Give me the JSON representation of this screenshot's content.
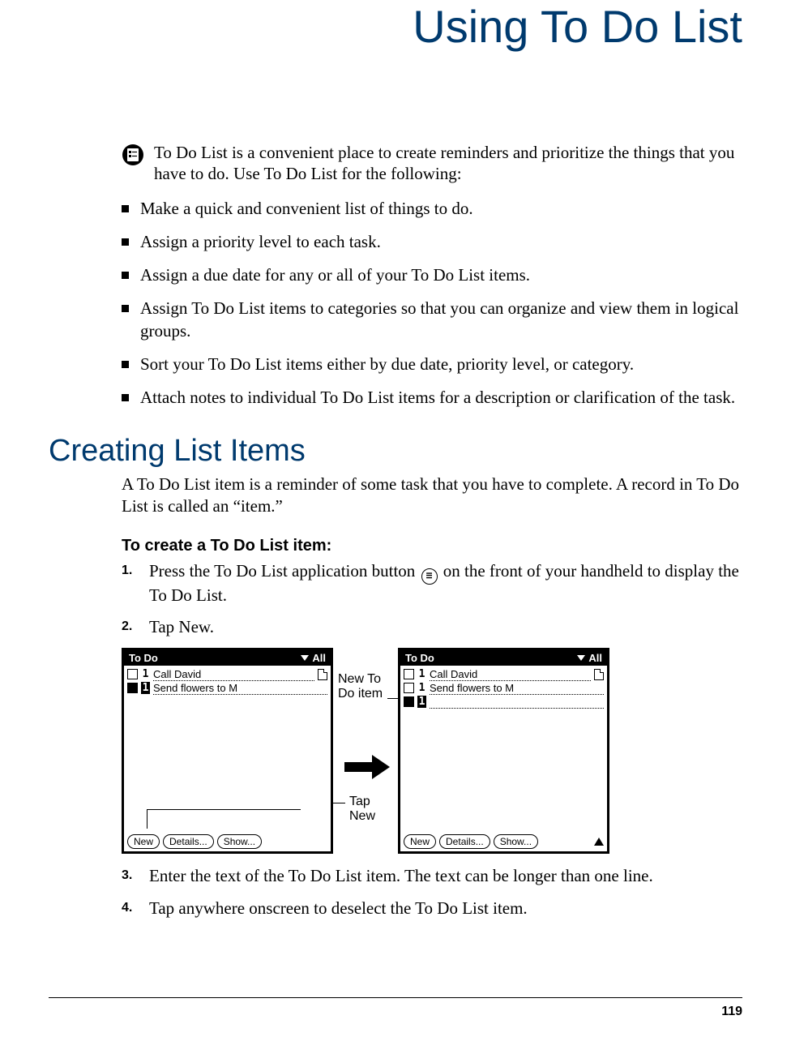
{
  "chapter_title": "Using To Do List",
  "intro": "To Do List is a convenient place to create reminders and prioritize the things that you have to do. Use To Do List for the following:",
  "bullets": [
    "Make a quick and convenient list of things to do.",
    "Assign a priority level to each task.",
    "Assign a due date for any or all of your To Do List items.",
    "Assign To Do List items to categories so that you can organize and view them in logical groups.",
    "Sort your To Do List items either by due date, priority level, or category.",
    "Attach notes to individual To Do List items for a description or clarification of the task."
  ],
  "section_title": "Creating List Items",
  "section_intro": "A To Do List item is a reminder of some task that you have to complete. A record in To Do List is called an “item.”",
  "subheading": "To create a To Do List item:",
  "steps": {
    "s1a": "Press the To Do List application button ",
    "s1b": " on the front of your handheld to display the To Do List.",
    "s2": "Tap New.",
    "s3": "Enter the text of the To Do List item. The text can be longer than one line.",
    "s4": "Tap anywhere onscreen to deselect the To Do List item."
  },
  "figure": {
    "label_new_item": "New To Do item",
    "label_tap_new": "Tap New",
    "screen": {
      "title": "To Do",
      "category": "All",
      "buttons": {
        "new": "New",
        "details": "Details...",
        "show": "Show..."
      },
      "items_left": [
        {
          "priority": "1",
          "text": "Call David",
          "note": true,
          "selected": false
        },
        {
          "priority": "1",
          "text": "Send flowers to M",
          "note": false,
          "selected": true
        }
      ],
      "items_right": [
        {
          "priority": "1",
          "text": "Call David",
          "note": true,
          "selected": false
        },
        {
          "priority": "1",
          "text": "Send flowers to M",
          "note": false,
          "selected": false
        },
        {
          "priority": "1",
          "text": "",
          "note": false,
          "selected": true
        }
      ]
    }
  },
  "page_number": "119"
}
